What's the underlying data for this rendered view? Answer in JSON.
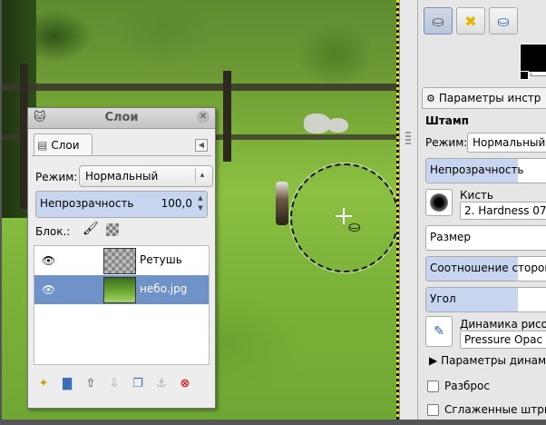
{
  "layers_dialog": {
    "title": "Слои",
    "tab_label": "Слои",
    "mode_label": "Режим:",
    "mode_value": "Нормальный",
    "opacity_label": "Непрозрачность",
    "opacity_value": "100,0",
    "opacity_fraction": 1.0,
    "lock_label": "Блок.:",
    "layers": [
      {
        "name": "Ретушь",
        "visible": true,
        "selected": false,
        "thumb": "transparent"
      },
      {
        "name": "небо.jpg",
        "visible": true,
        "selected": true,
        "thumb": "photo"
      }
    ],
    "icons": [
      "new-layer-icon",
      "new-layer-group-icon",
      "raise-layer-icon",
      "lower-layer-icon",
      "duplicate-layer-icon",
      "anchor-layer-icon",
      "delete-layer-icon"
    ]
  },
  "tool_options": {
    "panel_title": "Параметры инстр",
    "tool_name": "Штамп",
    "mode_label": "Режим:",
    "mode_value": "Нормальный",
    "opacity_label": "Непрозрачность",
    "opacity_fraction": 0.67,
    "brush_label": "Кисть",
    "brush_value": "2. Hardness 07",
    "size_label": "Размер",
    "size_fraction": 0.0,
    "aspect_label": "Соотношение сторон",
    "aspect_fraction": 0.67,
    "angle_label": "Угол",
    "angle_fraction": 0.67,
    "dynamics_label": "Динамика рисо",
    "dynamics_value": "Pressure Opac",
    "dynamics_options_label": "Параметры динам",
    "scatter_label": "Разброс",
    "smooth_label": "Сглаженные штри"
  },
  "colors": {
    "selection": "#6f93c8",
    "slider_fill": "#c7d6ee",
    "delete": "#d21b1b"
  }
}
